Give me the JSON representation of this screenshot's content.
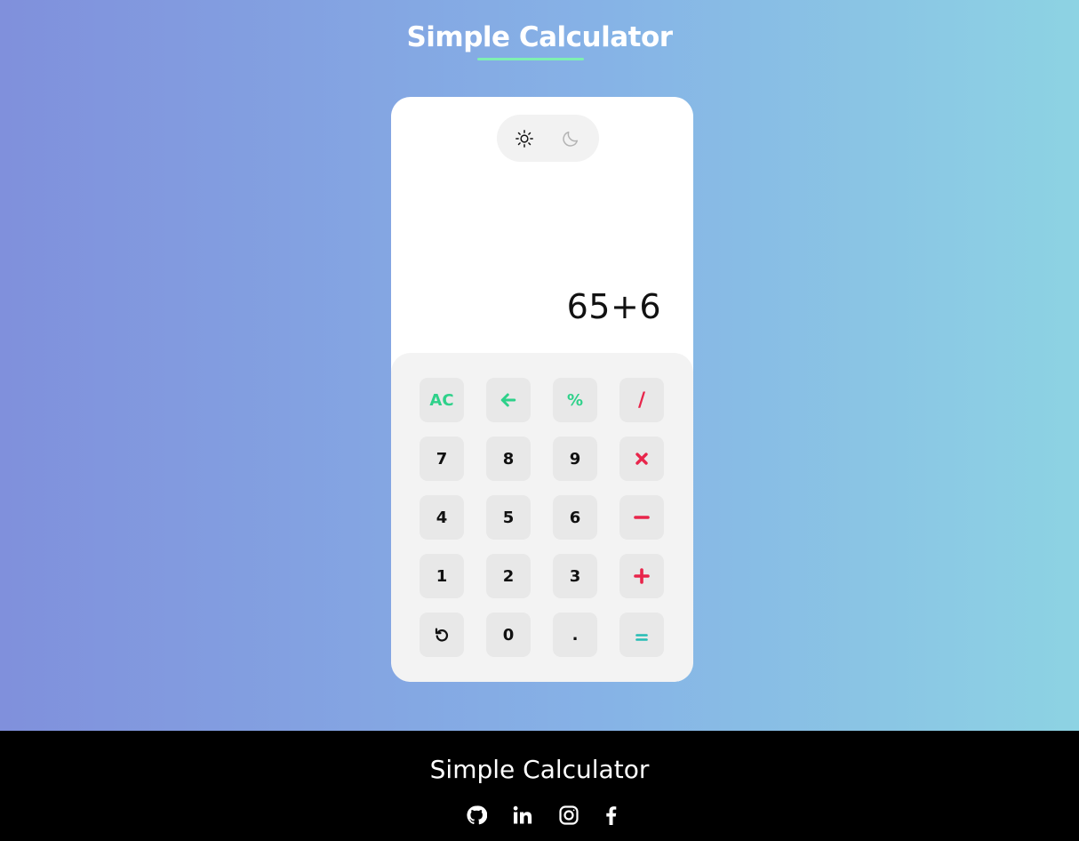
{
  "header": {
    "title": "Simple Calculator"
  },
  "theme_toggle": {
    "light_icon": "sun-icon",
    "dark_icon": "moon-icon"
  },
  "display": {
    "expression": "65+6"
  },
  "keypad": {
    "rows": [
      [
        {
          "label": "AC",
          "color": "#2ed18a"
        },
        {
          "label": "",
          "icon": "backspace-arrow-icon",
          "color": "#2ed18a"
        },
        {
          "label": "%",
          "color": "#2ed18a"
        },
        {
          "label": "/",
          "color": "#e8254b"
        }
      ],
      [
        {
          "label": "7"
        },
        {
          "label": "8"
        },
        {
          "label": "9"
        },
        {
          "label": "",
          "icon": "multiply-icon",
          "color": "#e8254b"
        }
      ],
      [
        {
          "label": "4"
        },
        {
          "label": "5"
        },
        {
          "label": "6"
        },
        {
          "label": "",
          "icon": "minus-icon",
          "color": "#e8254b"
        }
      ],
      [
        {
          "label": "1"
        },
        {
          "label": "2"
        },
        {
          "label": "3"
        },
        {
          "label": "",
          "icon": "plus-icon",
          "color": "#e8254b"
        }
      ],
      [
        {
          "label": "",
          "icon": "undo-icon"
        },
        {
          "label": "0"
        },
        {
          "label": "."
        },
        {
          "label": "",
          "icon": "equals-icon",
          "color": "#24bcb4"
        }
      ]
    ]
  },
  "footer": {
    "title": "Simple Calculator",
    "social_icons": [
      "github-icon",
      "linkedin-icon",
      "instagram-icon",
      "facebook-icon"
    ]
  },
  "colors": {
    "accent_green": "#2ed18a",
    "operator_red": "#e8254b",
    "equals_teal": "#24bcb4",
    "underline": "#7ef0b2"
  }
}
